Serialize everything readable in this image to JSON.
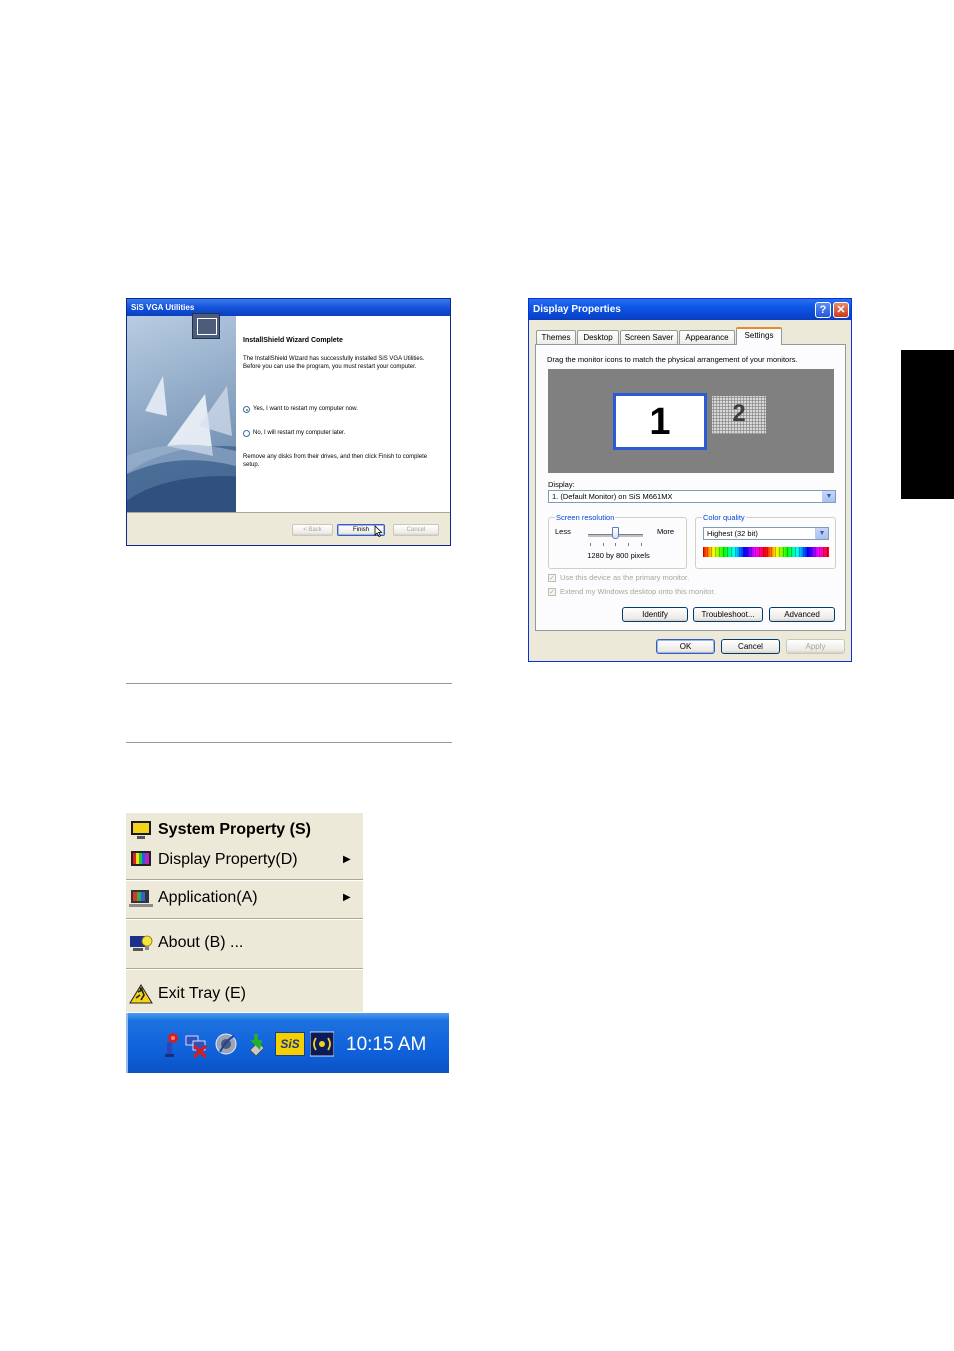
{
  "installer": {
    "title": "SiS VGA Utilities",
    "heading": "InstallShield Wizard Complete",
    "message": "The InstallShield Wizard has successfully installed SiS VGA Utilities.  Before you can use the program, you must restart your computer.",
    "option_yes": "Yes, I want to restart my computer now.",
    "option_no": "No, I will restart my computer later.",
    "remove_text": "Remove any disks from their drives, and then click Finish to complete setup.",
    "back_label": "< Back",
    "finish_label": "Finish",
    "cancel_label": "Cancel",
    "selected_option": "yes"
  },
  "display_properties": {
    "title": "Display Properties",
    "help_label": "?",
    "close_label": "✕",
    "tabs": [
      {
        "label": "Themes"
      },
      {
        "label": "Desktop"
      },
      {
        "label": "Screen Saver"
      },
      {
        "label": "Appearance"
      },
      {
        "label": "Settings"
      }
    ],
    "active_tab": "Settings",
    "instruction": "Drag the monitor icons to match the physical arrangement of your monitors.",
    "monitor1_label": "1",
    "monitor2_label": "2",
    "display_label": "Display:",
    "display_value": "1. (Default Monitor) on SiS M661MX",
    "screen_resolution": {
      "title": "Screen resolution",
      "less": "Less",
      "more": "More",
      "value": "1280 by 800 pixels"
    },
    "color_quality": {
      "title": "Color quality",
      "value": "Highest (32 bit)"
    },
    "primary_monitor_label": "Use this device as the primary monitor.",
    "extend_label": "Extend my Windows desktop onto this monitor.",
    "identify_label": "Identify",
    "troubleshoot_label": "Troubleshoot...",
    "advanced_label": "Advanced",
    "ok_label": "OK",
    "cancel_label": "Cancel",
    "apply_label": "Apply"
  },
  "tray_menu": {
    "items": [
      {
        "label": "System Property (S)",
        "icon": "monitor-icon"
      },
      {
        "label": "Display Property(D)",
        "icon": "color-bars-icon"
      },
      {
        "label": "Application(A)",
        "icon": "application-icon"
      },
      {
        "label": "About (B) ...",
        "icon": "lightbulb-icon"
      },
      {
        "label": "Exit Tray (E)",
        "icon": "exit-icon"
      }
    ],
    "submenu_arrow": "▶"
  },
  "taskbar": {
    "clock": "10:15 AM",
    "sis_label": "SiS",
    "icons": [
      "usb-icon",
      "network-disconnected-icon",
      "speaker-icon",
      "safely-remove-icon",
      "sis-icon",
      "wireless-icon"
    ]
  },
  "colors": {
    "xp_title_blue": "#0c55e6",
    "xp_dialog_bg": "#ece9d8",
    "taskbar_blue": "#0e5fd8",
    "active_tab_orange": "#e68b2c"
  }
}
